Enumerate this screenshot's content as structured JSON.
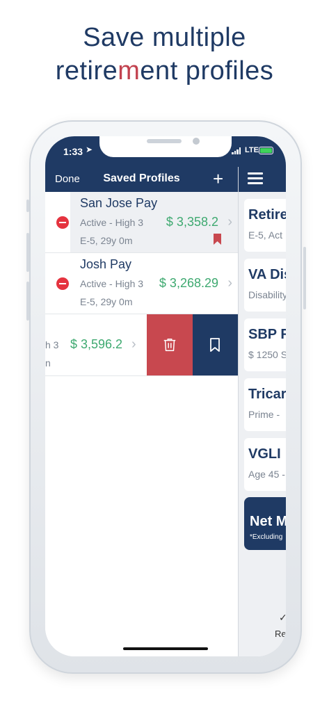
{
  "headline": {
    "line1": "Save multiple",
    "line2_pre": "retire",
    "line2_accent": "m",
    "line2_post": "ent profiles"
  },
  "status_bar": {
    "time": "1:33",
    "carrier": "LTE"
  },
  "nav": {
    "done_label": "Done",
    "title": "Saved Profiles",
    "add_label": "+"
  },
  "profiles": [
    {
      "name": "San Jose Pay",
      "status": "Active - High 3",
      "amount": "$ 3,358.2",
      "grade": "E-5, 29y 0m",
      "bookmarked": true
    },
    {
      "name": "Josh Pay",
      "status": "Active - High 3",
      "amount": "$ 3,268.29",
      "grade": "E-5, 29y 0m",
      "bookmarked": false
    }
  ],
  "swiped_row": {
    "status_fragment": "h 3",
    "amount": "$ 3,596.2",
    "grade_fragment": "n"
  },
  "right_panel": {
    "cards": [
      {
        "title": "Retire",
        "subtitle": "E-5, Act"
      },
      {
        "title": "VA Dis",
        "subtitle": "Disability"
      },
      {
        "title": "SBP F",
        "subtitle": "$ 1250 S"
      },
      {
        "title": "Tricar",
        "subtitle": "Prime - "
      },
      {
        "title": "VGLI ",
        "subtitle": "Age 45 -"
      }
    ],
    "net_card": {
      "title": "Net M",
      "subtitle": "*Excluding"
    },
    "bottom_label": "Re"
  },
  "colors": {
    "navy": "#1f3a64",
    "accent_red": "#c2424f",
    "money_green": "#3ea970",
    "delete_red": "#c8484f"
  }
}
